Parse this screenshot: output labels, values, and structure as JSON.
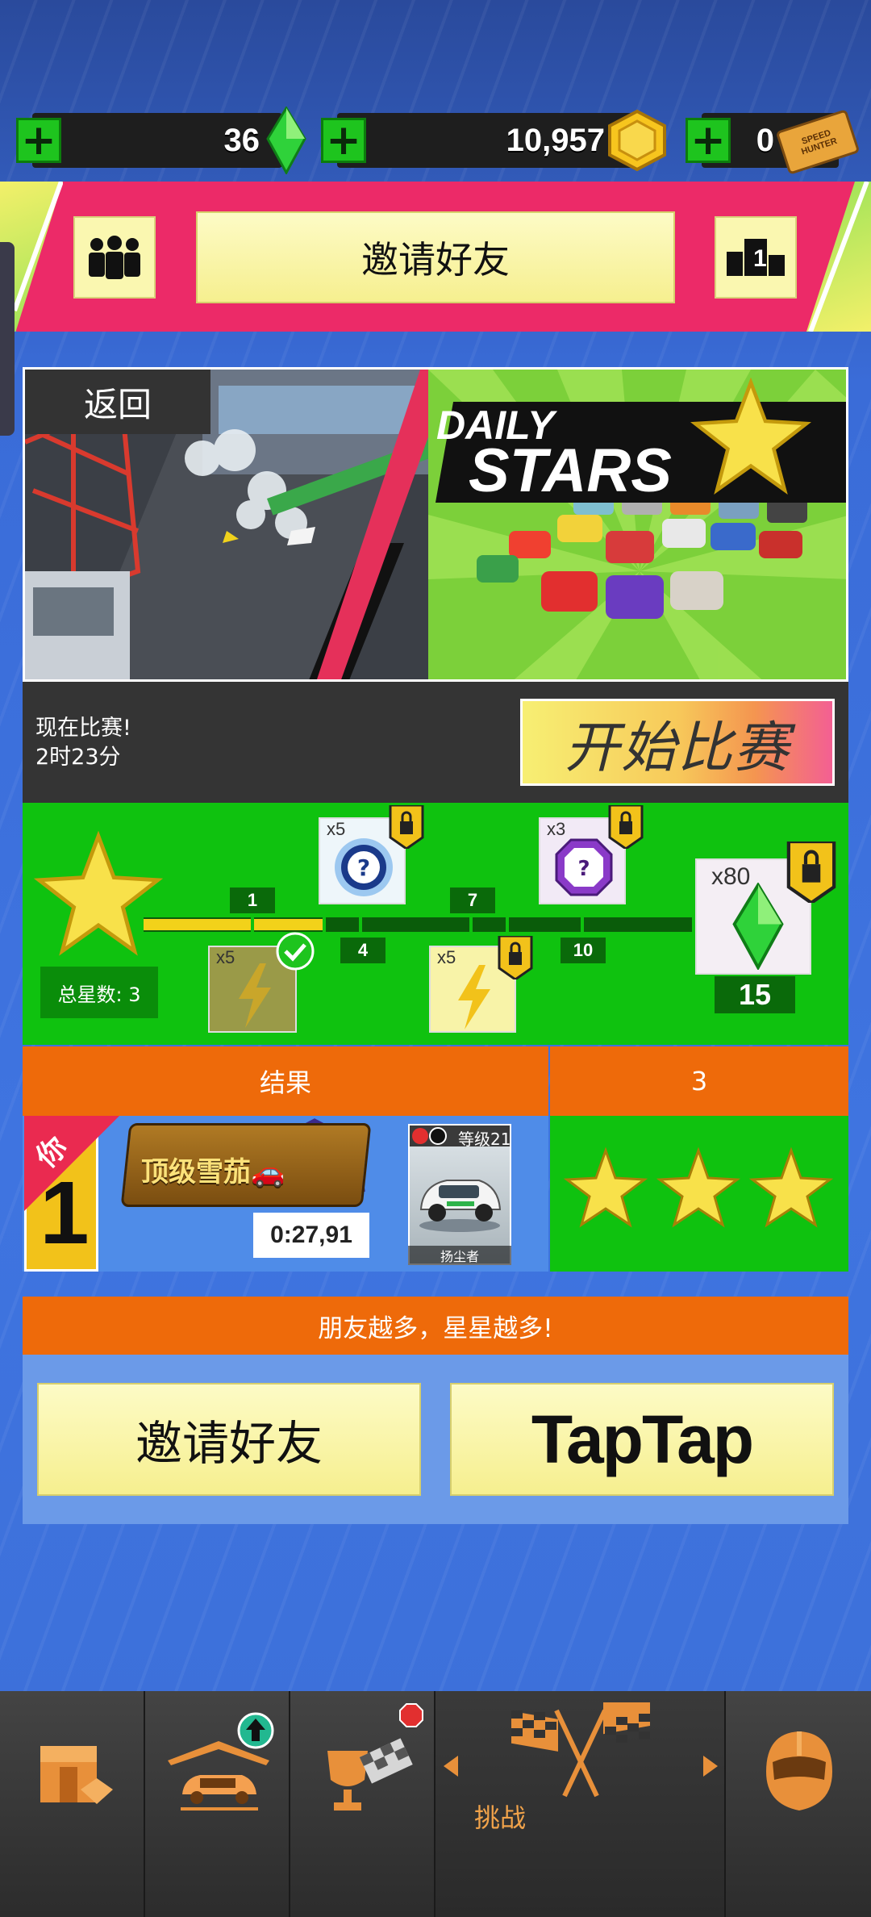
{
  "currency": {
    "gems": "36",
    "coins": "10,957",
    "tickets": "0",
    "ticket_icon_text": "SPEED HUNTER"
  },
  "header": {
    "invite_label": "邀请好友",
    "leaderboard_rank": "1"
  },
  "banner": {
    "back_label": "返回",
    "title_line1": "DAILY",
    "title_line2": "STARS"
  },
  "race": {
    "now_racing": "现在比赛!",
    "time_left": "2时23分",
    "start_label": "开始比赛"
  },
  "progress": {
    "total_stars_label": "总星数: 3",
    "stars_collected": 3,
    "milestones": [
      "1",
      "4",
      "7",
      "10"
    ],
    "rewards": [
      {
        "qty": "x5",
        "type": "lightning",
        "claimed": true
      },
      {
        "qty": "x5",
        "type": "blue-mystery",
        "locked": true
      },
      {
        "qty": "x5",
        "type": "lightning",
        "locked": true
      },
      {
        "qty": "x3",
        "type": "purple-mystery",
        "locked": true
      },
      {
        "qty": "x80",
        "type": "gem",
        "locked": true
      }
    ],
    "final_milestone": "15"
  },
  "results": {
    "header_label": "结果",
    "stars_header": "3",
    "you_label": "你",
    "rank": "1",
    "title_plate": "顶级雪茄🚗",
    "time": "0:27,91",
    "car_level": "等级21",
    "car_name": "扬尘者"
  },
  "friends": {
    "banner": "朋友越多，星星越多!",
    "invite_label": "邀请好友",
    "taptap_label": "TapTap"
  },
  "nav": {
    "active_label": "挑战"
  },
  "colors": {
    "pink": "#ec2a68",
    "green": "#0fc20f",
    "orange": "#ee6a0a",
    "blue": "#3f74e0",
    "nav_accent": "#f0a24a"
  }
}
